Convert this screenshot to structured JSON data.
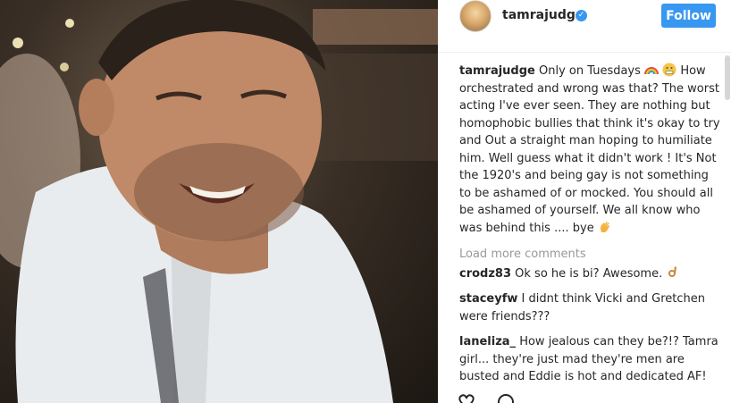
{
  "post": {
    "username": "tamrajudge",
    "verified": true,
    "follow_label": "Follow",
    "caption": {
      "username": "tamrajudge",
      "text_part1": "Only on Tuesdays",
      "text_part2": "How orchestrated and wrong was that? The worst acting I've ever seen. They are nothing but homophobic bullies that think it's okay to try and Out a straight man hoping to humiliate him. Well guess what it didn't work ! It's Not the 1920's and being gay is not something to be ashamed of or mocked. You should all be ashamed of yourself. We all know who was behind this .... bye"
    },
    "load_more_label": "Load more comments",
    "comments": [
      {
        "username": "crodz83",
        "text": "Ok so he is bi? Awesome."
      },
      {
        "username": "staceyfw",
        "text": "I didnt think Vicki and Gretchen were friends???"
      },
      {
        "username": "laneliza_",
        "text": "How jealous can they be?!? Tamra girl... they're just mad they're men are busted and Eddie is hot and dedicated AF!"
      }
    ]
  },
  "icons": {
    "verified": "verified-badge-icon",
    "rainbow": "rainbow-emoji",
    "grimace": "grimacing-face-emoji",
    "wave": "waving-hand-emoji",
    "ok": "ok-hand-emoji",
    "like": "heart-icon",
    "comment": "comment-icon"
  },
  "colors": {
    "accent": "#3897f0",
    "muted": "#999999",
    "text": "#262626"
  }
}
